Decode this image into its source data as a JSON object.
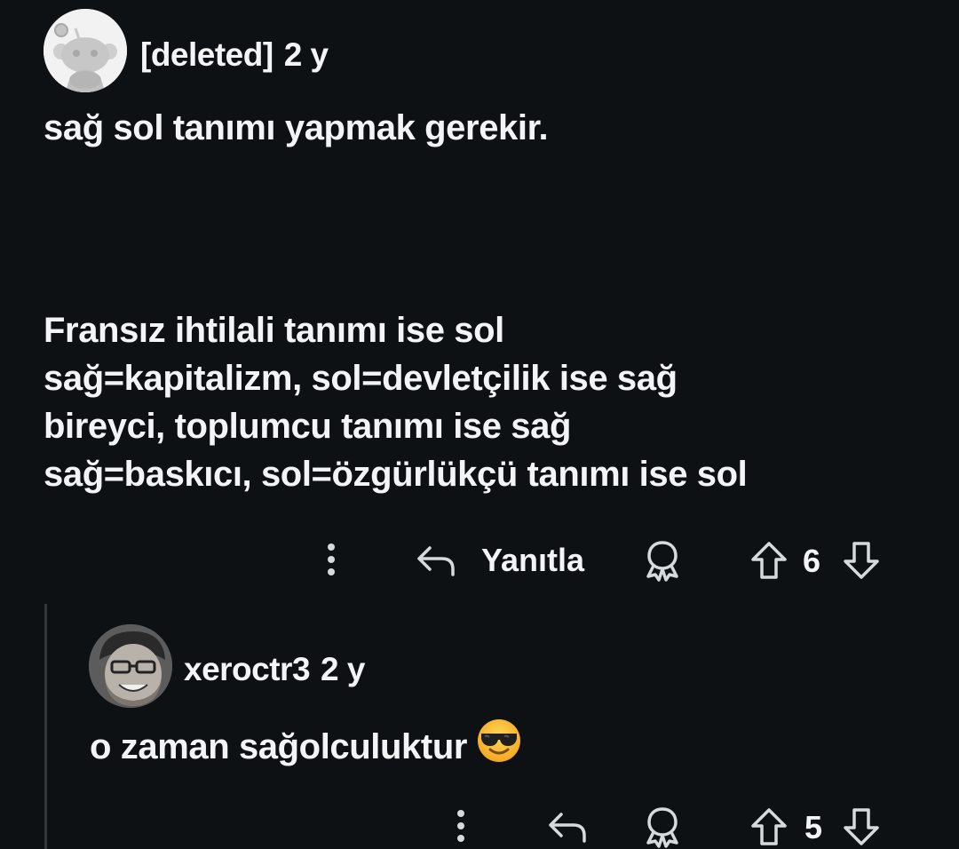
{
  "comment": {
    "author": "[deleted]",
    "age": "2 y",
    "avatar_icon": "reddit-snoo-default-avatar",
    "paragraphs": [
      [
        "sağ sol tanımı yapmak gerekir."
      ],
      [
        "Fransız ihtilali tanımı ise sol",
        "sağ=kapitalizm, sol=devletçilik ise sağ",
        "bireyci, toplumcu tanımı ise sağ",
        "sağ=baskıcı, sol=özgürlükçü tanımı ise sol"
      ]
    ],
    "actions": {
      "more_icon": "vertical-ellipsis-icon",
      "reply_icon": "reply-arrow-icon",
      "reply_label": "Yanıtla",
      "award_icon": "award-ribbon-icon",
      "upvote_icon": "upvote-arrow-icon",
      "score": "6",
      "downvote_icon": "downvote-arrow-icon"
    }
  },
  "reply": {
    "author": "xeroctr3",
    "age": "2 y",
    "avatar_icon": "user-photo-avatar",
    "text": "o zaman sağolculuktur",
    "emoji_icon": "smiling-face-with-sunglasses-emoji",
    "actions": {
      "more_icon": "vertical-ellipsis-icon",
      "reply_icon": "reply-arrow-icon",
      "award_icon": "award-ribbon-icon",
      "upvote_icon": "upvote-arrow-icon",
      "score": "5",
      "downvote_icon": "downvote-arrow-icon"
    }
  },
  "colors": {
    "background": "#0e1113",
    "text": "#f2f4f5",
    "icon": "#d7dadc",
    "thread_line": "#343536"
  }
}
